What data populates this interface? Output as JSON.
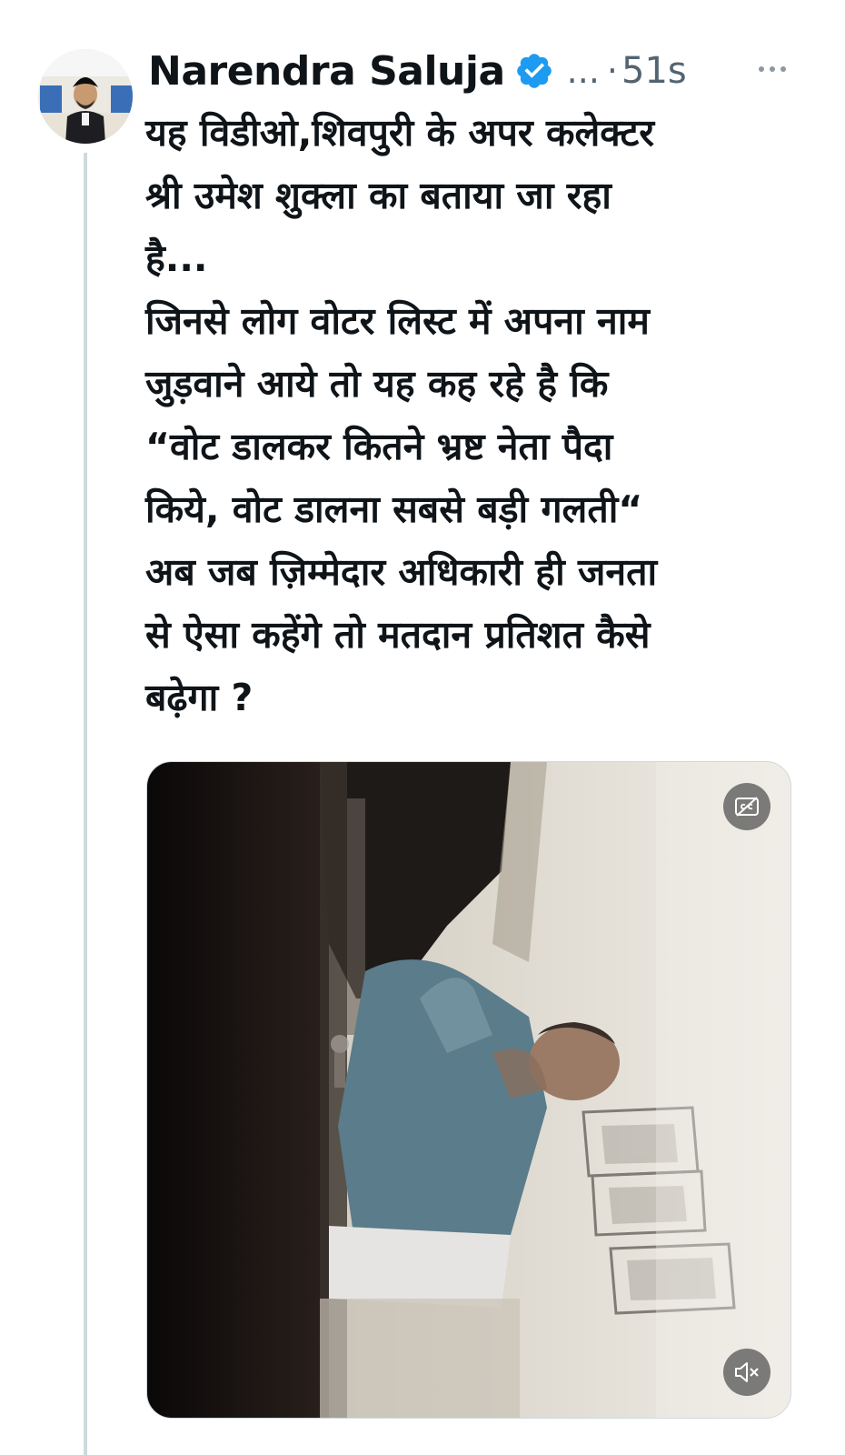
{
  "tweet": {
    "author_name": "Narendra Saluja",
    "handle_truncated": "...",
    "separator": "·",
    "time": "51s",
    "text": "यह विडीओ,शिवपुरी के अपर कलेक्टर\nश्री उमेश शुक्ला का बताया जा रहा\nहै...\nजिनसे लोग वोटर लिस्ट में अपना नाम\nजुड़वाने आये तो यह कह रहे है कि\n“वोट डालकर कितने भ्रष्ट नेता पैदा\nकिये, वोट डालना सबसे बड़ी गलती“\nअब जब ज़िम्मेदार अधिकारी ही जनता\nसे ऐसा कहेंगे तो मतदान प्रतिशत कैसे\nबढ़ेगा ?"
  },
  "icons": {
    "avatar": "avatar-photo",
    "verified": "verified-badge-icon",
    "more": "more-horizontal-icon",
    "captions": "closed-captions-off-icon",
    "mute": "volume-muted-icon"
  },
  "colors": {
    "text": "#0f1419",
    "secondary": "#536471",
    "verified": "#1d9bf0",
    "thread_line": "#cfd9de"
  }
}
